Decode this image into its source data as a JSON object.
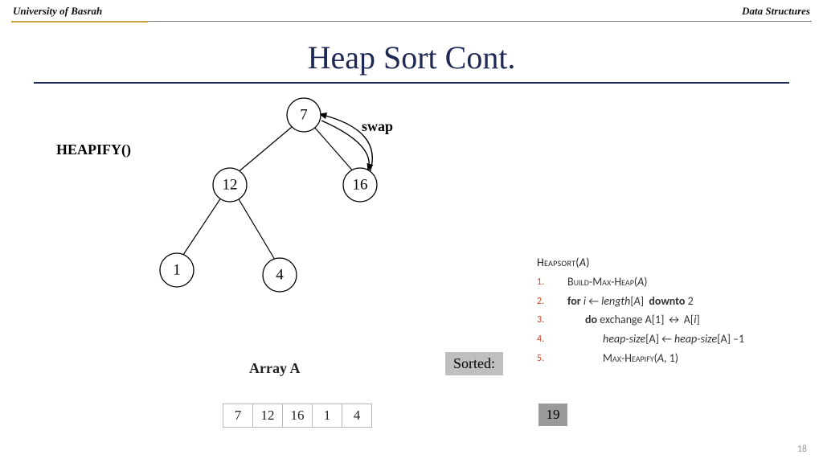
{
  "header": {
    "left": "University of Basrah",
    "right": "Data Structures"
  },
  "title": "Heap Sort Cont.",
  "labels": {
    "heapify": "HEAPIFY()",
    "swap": "swap",
    "array": "Array A",
    "sorted": "Sorted:"
  },
  "tree": {
    "nodes": {
      "root": "7",
      "left": "12",
      "right": "16",
      "ll": "1",
      "lr": "4"
    }
  },
  "array": [
    "7",
    "12",
    "16",
    "1",
    "4"
  ],
  "sorted_cells": [
    "19"
  ],
  "algorithm": {
    "title": "Heapsort",
    "arg": "A",
    "lines": [
      {
        "n": "1.",
        "indent": 1,
        "html": "<span class='sc'>Build-Max-Heap</span>(<span class='it'>A</span>)"
      },
      {
        "n": "2.",
        "indent": 1,
        "html": "<span class='kw'>for</span> <span class='it'>i</span> ← <span class='it'>length</span>[<span class='it'>A</span>]&nbsp; <span class='kw'>downto</span> 2"
      },
      {
        "n": "3.",
        "indent": 2,
        "html": "<span class='kw'>do</span> exchange A[1] ↔ A[<span class='it'>i</span>]"
      },
      {
        "n": "4.",
        "indent": 3,
        "html": "<span class='it'>heap-size</span>[A] ← <span class='it'>heap-size</span>[A] –1"
      },
      {
        "n": "5.",
        "indent": 3,
        "html": "<span class='sc'>Max-Heapify</span>(<span class='it'>A</span>, 1)"
      }
    ]
  },
  "page_number": "18"
}
